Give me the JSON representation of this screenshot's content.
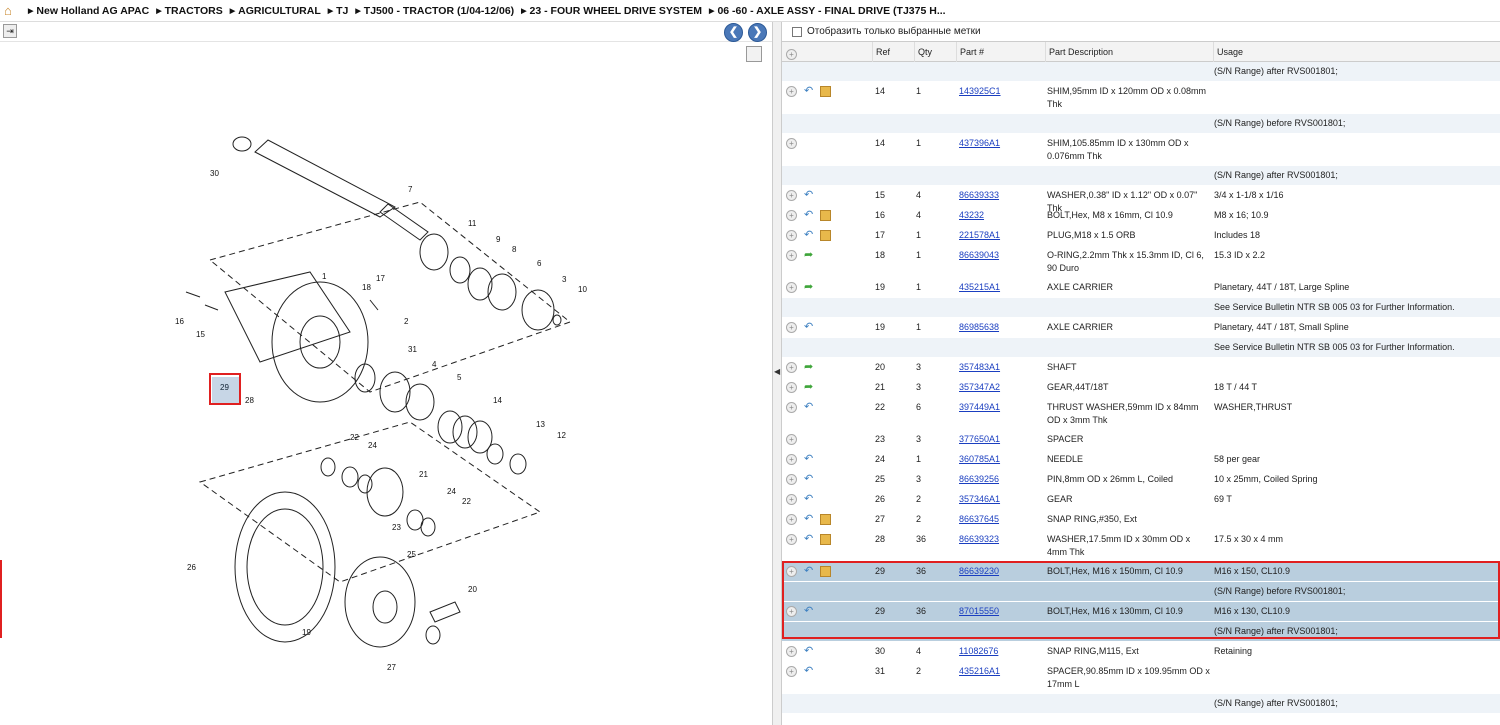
{
  "breadcrumb": [
    "New Holland AG APAC",
    "TRACTORS",
    "AGRICULTURAL",
    "TJ",
    "TJ500 - TRACTOR (1/04-12/06)",
    "23 - FOUR WHEEL DRIVE SYSTEM",
    "06 -60 - AXLE ASSY - FINAL DRIVE (TJ375 H..."
  ],
  "filter_label": "Отобразить только выбранные метки",
  "columns": {
    "ref": "Ref",
    "qty": "Qty",
    "part": "Part #",
    "desc": "Part Description",
    "usage": "Usage"
  },
  "rows": [
    {
      "kind": "note",
      "usage": "(S/N Range) after RVS001801;"
    },
    {
      "kind": "part",
      "icons": "rb",
      "ref": "14",
      "qty": "1",
      "part": "143925C1",
      "desc": "SHIM,95mm ID x 120mm OD x 0.08mm Thk",
      "usage": ""
    },
    {
      "kind": "note",
      "usage": "(S/N Range) before RVS001801;"
    },
    {
      "kind": "part",
      "icons": "",
      "ref": "14",
      "qty": "1",
      "part": "437396A1",
      "desc": "SHIM,105.85mm ID x 130mm OD x 0.076mm Thk",
      "usage": ""
    },
    {
      "kind": "note",
      "usage": "(S/N Range) after RVS001801;"
    },
    {
      "kind": "part",
      "icons": "r",
      "ref": "15",
      "qty": "4",
      "part": "86639333",
      "desc": "WASHER,0.38\" ID x 1.12\" OD x 0.07\" Thk",
      "usage": "3/4 x 1-1/8 x 1/16"
    },
    {
      "kind": "part",
      "icons": "rb",
      "ref": "16",
      "qty": "4",
      "part": "43232",
      "desc": "BOLT,Hex, M8 x 16mm, Cl 10.9",
      "usage": "M8 x 16; 10.9"
    },
    {
      "kind": "part",
      "icons": "rb",
      "ref": "17",
      "qty": "1",
      "part": "221578A1",
      "desc": "PLUG,M18 x 1.5 ORB",
      "usage": "Includes 18"
    },
    {
      "kind": "part",
      "icons": "g",
      "ref": "18",
      "qty": "1",
      "part": "86639043",
      "desc": "O-RING,2.2mm Thk x 15.3mm ID, Cl 6, 90 Duro",
      "usage": "15.3 ID x 2.2"
    },
    {
      "kind": "part",
      "icons": "g",
      "ref": "19",
      "qty": "1",
      "part": "435215A1",
      "desc": "AXLE CARRIER",
      "usage": "Planetary, 44T / 18T, Large Spline"
    },
    {
      "kind": "note",
      "usage": "See Service Bulletin NTR SB 005 03 for Further Information."
    },
    {
      "kind": "part",
      "icons": "r",
      "ref": "19",
      "qty": "1",
      "part": "86985638",
      "desc": "AXLE CARRIER",
      "usage": "Planetary, 44T / 18T, Small Spline"
    },
    {
      "kind": "note",
      "usage": "See Service Bulletin NTR SB 005 03 for Further Information."
    },
    {
      "kind": "part",
      "icons": "g",
      "ref": "20",
      "qty": "3",
      "part": "357483A1",
      "desc": "SHAFT",
      "usage": ""
    },
    {
      "kind": "part",
      "icons": "g",
      "ref": "21",
      "qty": "3",
      "part": "357347A2",
      "desc": "GEAR,44T/18T",
      "usage": "18 T / 44 T"
    },
    {
      "kind": "part",
      "icons": "r",
      "ref": "22",
      "qty": "6",
      "part": "397449A1",
      "desc": "THRUST WASHER,59mm ID x 84mm OD x 3mm Thk",
      "usage": "WASHER,THRUST"
    },
    {
      "kind": "part",
      "icons": "",
      "ref": "23",
      "qty": "3",
      "part": "377650A1",
      "desc": "SPACER",
      "usage": ""
    },
    {
      "kind": "part",
      "icons": "r",
      "ref": "24",
      "qty": "1",
      "part": "360785A1",
      "desc": "NEEDLE",
      "usage": "58 per gear"
    },
    {
      "kind": "part",
      "icons": "r",
      "ref": "25",
      "qty": "3",
      "part": "86639256",
      "desc": "PIN,8mm OD x 26mm L, Coiled",
      "usage": "10 x 25mm, Coiled Spring"
    },
    {
      "kind": "part",
      "icons": "r",
      "ref": "26",
      "qty": "2",
      "part": "357346A1",
      "desc": "GEAR",
      "usage": "69 T"
    },
    {
      "kind": "part",
      "icons": "rb",
      "ref": "27",
      "qty": "2",
      "part": "86637645",
      "desc": "SNAP RING,#350, Ext",
      "usage": ""
    },
    {
      "kind": "part",
      "icons": "rb",
      "ref": "28",
      "qty": "36",
      "part": "86639323",
      "desc": "WASHER,17.5mm ID x 30mm OD x 4mm Thk",
      "usage": "17.5 x 30 x 4 mm"
    },
    {
      "kind": "part",
      "sel": true,
      "icons": "rb",
      "ref": "29",
      "qty": "36",
      "part": "86639230",
      "desc": "BOLT,Hex, M16 x 150mm, Cl 10.9",
      "usage": "M16 x 150, CL10.9"
    },
    {
      "kind": "note",
      "sel": true,
      "usage": "(S/N Range) before RVS001801;"
    },
    {
      "kind": "part",
      "sel": true,
      "icons": "r",
      "ref": "29",
      "qty": "36",
      "part": "87015550",
      "desc": "BOLT,Hex, M16 x 130mm, Cl 10.9",
      "usage": "M16 x 130, CL10.9"
    },
    {
      "kind": "note",
      "sel": true,
      "usage": "(S/N Range) after RVS001801;"
    },
    {
      "kind": "part",
      "icons": "r",
      "ref": "30",
      "qty": "4",
      "part": "11082676",
      "desc": "SNAP RING,M115, Ext",
      "usage": "Retaining"
    },
    {
      "kind": "part",
      "icons": "r",
      "ref": "31",
      "qty": "2",
      "part": "435216A1",
      "desc": "SPACER,90.85mm ID x 109.95mm OD x 17mm L",
      "usage": ""
    },
    {
      "kind": "note",
      "usage": "(S/N Range) after RVS001801;"
    }
  ],
  "diagram_labels": [
    "30",
    "7",
    "11",
    "9",
    "8",
    "6",
    "3",
    "10",
    "1",
    "17",
    "18",
    "16",
    "15",
    "2",
    "31",
    "4",
    "5",
    "29",
    "28",
    "14",
    "13",
    "12",
    "22",
    "24",
    "21",
    "24",
    "22",
    "23",
    "25",
    "26",
    "20",
    "19",
    "27"
  ]
}
